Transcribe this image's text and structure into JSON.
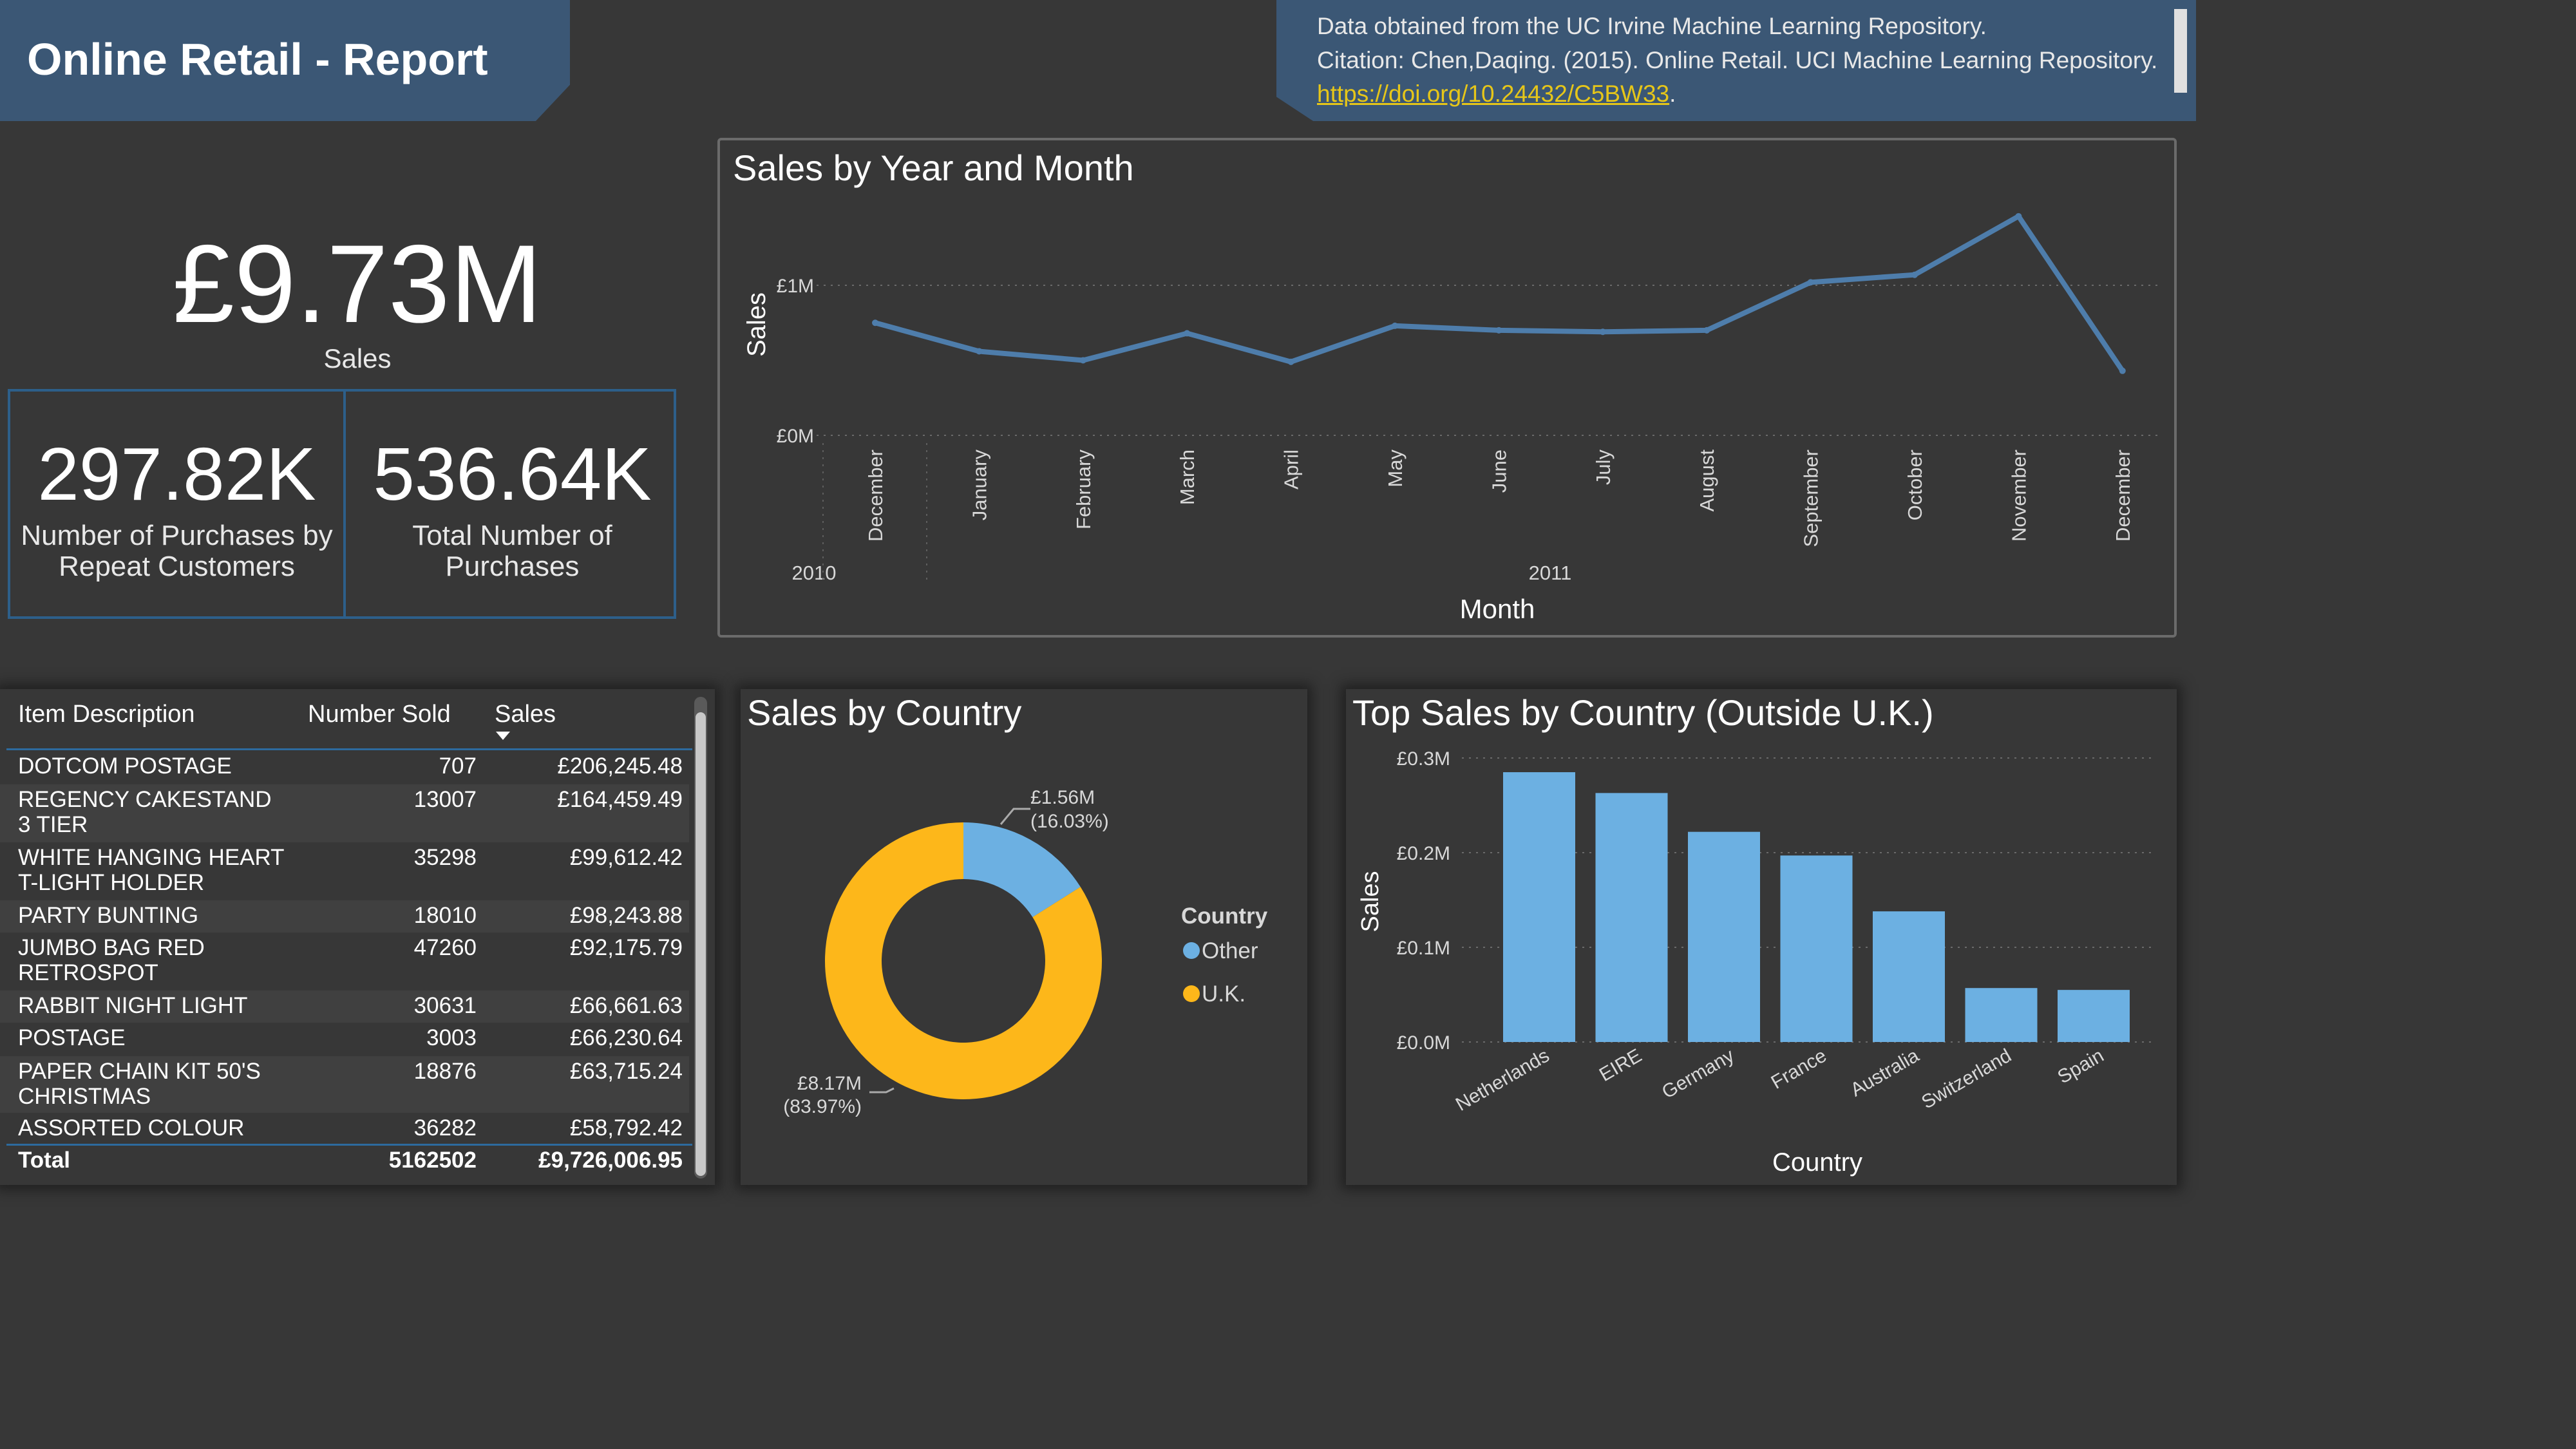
{
  "header": {
    "title": "Online Retail - Report",
    "citation_line1": "Data obtained from the UC Irvine Machine Learning Repository.",
    "citation_line2": "Citation: Chen,Daqing. (2015). Online Retail. UCI Machine Learning Repository.",
    "citation_link": "https://doi.org/10.24432/C5BW33",
    "citation_link_suffix": "."
  },
  "kpis": {
    "sales_value": "£9.73M",
    "sales_label": "Sales",
    "repeat_value": "297.82K",
    "repeat_label_line1": "Number of Purchases by",
    "repeat_label_line2": "Repeat Customers",
    "total_value": "536.64K",
    "total_label_line1": "Total Number of",
    "total_label_line2": "Purchases"
  },
  "line_chart": {
    "title": "Sales by Year and Month",
    "ylabel": "Sales",
    "xlabel": "Month",
    "y_ticks": [
      "£0M",
      "£1M"
    ],
    "years": [
      "2010",
      "2011"
    ],
    "color": "#4e7dab"
  },
  "table": {
    "headers": [
      "Item Description",
      "Number Sold",
      "Sales"
    ],
    "rows": [
      {
        "desc1": "DOTCOM POSTAGE",
        "desc2": "",
        "sold": "707",
        "sales": "£206,245.48"
      },
      {
        "desc1": "REGENCY CAKESTAND",
        "desc2": "3 TIER",
        "sold": "13007",
        "sales": "£164,459.49"
      },
      {
        "desc1": "WHITE HANGING HEART",
        "desc2": "T-LIGHT HOLDER",
        "sold": "35298",
        "sales": "£99,612.42"
      },
      {
        "desc1": "PARTY BUNTING",
        "desc2": "",
        "sold": "18010",
        "sales": "£98,243.88"
      },
      {
        "desc1": "JUMBO BAG RED",
        "desc2": "RETROSPOT",
        "sold": "47260",
        "sales": "£92,175.79"
      },
      {
        "desc1": "RABBIT NIGHT LIGHT",
        "desc2": "",
        "sold": "30631",
        "sales": "£66,661.63"
      },
      {
        "desc1": "POSTAGE",
        "desc2": "",
        "sold": "3003",
        "sales": "£66,230.64"
      },
      {
        "desc1": "PAPER CHAIN KIT 50'S",
        "desc2": "CHRISTMAS",
        "sold": "18876",
        "sales": "£63,715.24"
      },
      {
        "desc1": "ASSORTED COLOUR",
        "desc2": "",
        "sold": "36282",
        "sales": "£58,792.42"
      }
    ],
    "total_label": "Total",
    "total_sold": "5162502",
    "total_sales": "£9,726,006.95"
  },
  "donut": {
    "title": "Sales by Country",
    "legend_title": "Country",
    "other_label": "£1.56M",
    "other_pct": "(16.03%)",
    "uk_label": "£8.17M",
    "uk_pct": "(83.97%)"
  },
  "bar_chart": {
    "title": "Top Sales by Country (Outside U.K.)",
    "ylabel": "Sales",
    "xlabel": "Country",
    "y_ticks": [
      "£0.0M",
      "£0.1M",
      "£0.2M",
      "£0.3M"
    ],
    "color": "#6cb0e2"
  },
  "chart_data": [
    {
      "type": "line",
      "title": "Sales by Year and Month",
      "xlabel": "Month",
      "ylabel": "Sales",
      "x": [
        "December 2010",
        "January 2011",
        "February 2011",
        "March 2011",
        "April 2011",
        "May 2011",
        "June 2011",
        "July 2011",
        "August 2011",
        "September 2011",
        "October 2011",
        "November 2011",
        "December 2011"
      ],
      "x_tick_labels": [
        "December",
        "January",
        "February",
        "March",
        "April",
        "May",
        "June",
        "July",
        "August",
        "September",
        "October",
        "November",
        "December"
      ],
      "values": [
        0.75,
        0.56,
        0.5,
        0.68,
        0.49,
        0.73,
        0.7,
        0.69,
        0.7,
        1.02,
        1.07,
        1.46,
        0.43
      ],
      "units": "£M",
      "ylim": [
        0,
        1.55
      ],
      "grid": true
    },
    {
      "type": "pie",
      "title": "Sales by Country",
      "legend_title": "Country",
      "categories": [
        "Other",
        "U.K."
      ],
      "values": [
        1.56,
        8.17
      ],
      "percent": [
        16.03,
        83.97
      ],
      "colors": [
        "#6cb0e2",
        "#fdb71a"
      ],
      "legend": "right"
    },
    {
      "type": "bar",
      "title": "Top Sales by Country (Outside U.K.)",
      "xlabel": "Country",
      "ylabel": "Sales",
      "categories": [
        "Netherlands",
        "EIRE",
        "Germany",
        "France",
        "Australia",
        "Switzerland",
        "Spain"
      ],
      "values": [
        0.285,
        0.263,
        0.222,
        0.197,
        0.138,
        0.057,
        0.055
      ],
      "units": "£M",
      "ylim": [
        0,
        0.3
      ],
      "grid": true
    }
  ]
}
